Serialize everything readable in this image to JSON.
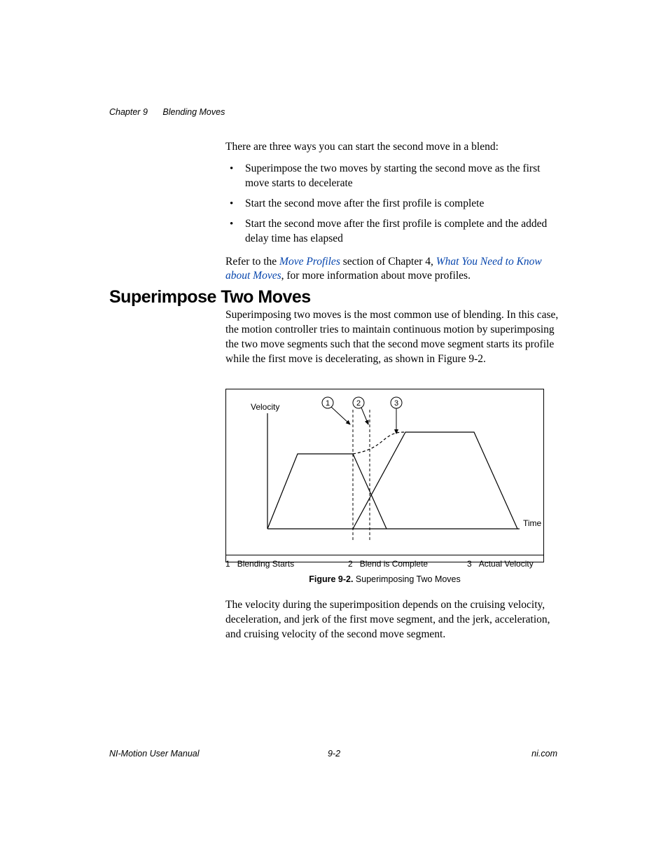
{
  "header": {
    "chapter": "Chapter 9",
    "title": "Blending Moves"
  },
  "intro": {
    "lead": "There are three ways you can start the second move in a blend:",
    "bullets": [
      "Superimpose the two moves by starting the second move as the first move starts to decelerate",
      "Start the second move after the first profile is complete",
      "Start the second move after the first profile is complete and the added delay time has elapsed"
    ],
    "refer_pre": "Refer to the ",
    "link1": "Move Profiles",
    "refer_mid": " section of Chapter 4, ",
    "link2": "What You Need to Know about Moves",
    "refer_post": ", for more information about move profiles."
  },
  "section": {
    "heading": "Superimpose Two Moves",
    "body": "Superimposing two moves is the most common use of blending. In this case, the motion controller tries to maintain continuous motion by superimposing the two move segments such that the second move segment starts its profile while the first move is decelerating, as shown in Figure 9-2."
  },
  "figure": {
    "yaxis": "Velocity",
    "xaxis": "Time",
    "callout1": "1",
    "callout2": "2",
    "callout3": "3",
    "legend": [
      {
        "num": "1",
        "text": "Blending Starts"
      },
      {
        "num": "2",
        "text": "Blend is Complete"
      },
      {
        "num": "3",
        "text": "Actual Velocity"
      }
    ],
    "caption_bold": "Figure 9-2.  ",
    "caption_text": "Superimposing Two Moves"
  },
  "after": "The velocity during the superimposition depends on the cruising velocity, deceleration, and jerk of the first move segment, and the jerk, acceleration, and cruising velocity of the second move segment.",
  "footer": {
    "left": "NI-Motion User Manual",
    "center": "9-2",
    "right": "ni.com"
  }
}
